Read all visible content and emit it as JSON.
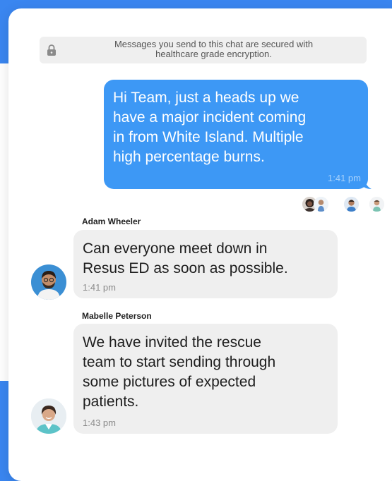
{
  "encryption_notice": {
    "line1": "Messages you send to this chat are secured with",
    "line2": "healthcare grade encryption.",
    "icon": "lock-icon"
  },
  "messages": [
    {
      "direction": "outgoing",
      "lines": [
        "Hi Team, just a heads up we",
        "have a major incident coming",
        "in from White Island. Multiple",
        "high percentage burns."
      ],
      "time": "1:41 pm"
    },
    {
      "direction": "incoming",
      "sender": "Adam Wheeler",
      "lines": [
        "Can everyone meet down in",
        "Resus ED as soon as possible."
      ],
      "time": "1:41 pm"
    },
    {
      "direction": "incoming",
      "sender": "Mabelle Peterson",
      "lines": [
        "We have invited the rescue",
        "team to start sending through",
        "some pictures of expected",
        "patients."
      ],
      "time": "1:43 pm"
    }
  ],
  "read_receipts": 4,
  "colors": {
    "accent": "#3a86f0",
    "outgoing_bubble": "#3d98f5",
    "incoming_bubble": "#efefef"
  }
}
